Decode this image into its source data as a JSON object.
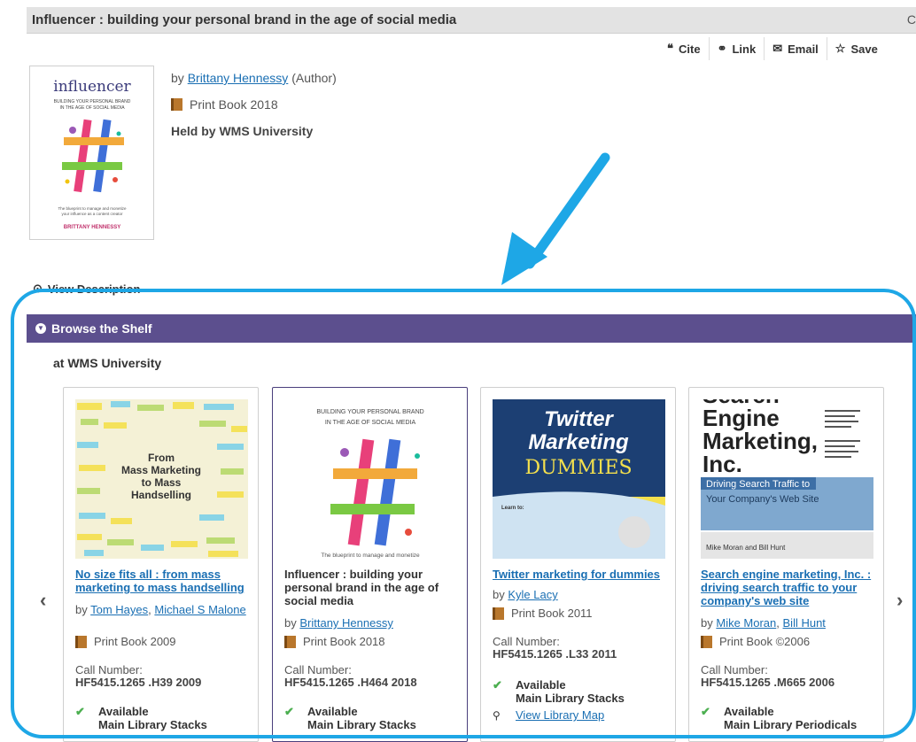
{
  "record": {
    "title": "Influencer : building your personal brand in the age of social media",
    "edge_glyph": "C",
    "by_prefix": "by",
    "author": "Brittany Hennessy",
    "author_role": "(Author)",
    "format": "Print Book 2018",
    "held_by": "Held by WMS University"
  },
  "actions": [
    {
      "label": "Cite",
      "icon": "quote-icon",
      "glyph": "❝"
    },
    {
      "label": "Link",
      "icon": "link-icon",
      "glyph": "⚭"
    },
    {
      "label": "Email",
      "icon": "envelope-icon",
      "glyph": "✉"
    },
    {
      "label": "Save",
      "icon": "star-icon",
      "glyph": "☆"
    }
  ],
  "cover": {
    "title": "influencer",
    "subtitle_1": "BUILDING YOUR PERSONAL BRAND",
    "subtitle_2": "IN THE AGE OF SOCIAL MEDIA",
    "blurb_1": "The blueprint to manage and monetize",
    "blurb_2": "your influence as a content creator",
    "author": "BRITTANY HENNESSY"
  },
  "view_description": "View Description",
  "shelf": {
    "header": "Browse the Shelf",
    "location": "at WMS University",
    "prev_glyph": "‹",
    "next_glyph": "›",
    "books": [
      {
        "title": "No size fits all : from mass marketing to mass handselling",
        "by_prefix": "by",
        "authors": [
          "Tom Hayes",
          "Michael S Malone"
        ],
        "format": "Print Book 2009",
        "call_label": "Call Number:",
        "call_number": "HF5415.1265 .H39 2009",
        "availability": "Available",
        "location": "Main Library Stacks",
        "cover_text": [
          "From",
          "Mass Marketing",
          "to Mass",
          "Handselling"
        ]
      },
      {
        "title": "Influencer : building your personal brand in the age of social media",
        "by_prefix": "by",
        "authors": [
          "Brittany Hennessy"
        ],
        "format": "Print Book 2018",
        "call_label": "Call Number:",
        "call_number": "HF5415.1265 .H464 2018",
        "availability": "Available",
        "location": "Main Library Stacks",
        "cover_text": [
          "BUILDING YOUR PERSONAL BRAND",
          "IN THE AGE OF SOCIAL MEDIA",
          "The blueprint to manage and monetize"
        ]
      },
      {
        "title": "Twitter marketing for dummies",
        "by_prefix": "by",
        "authors": [
          "Kyle Lacy"
        ],
        "format": "Print Book 2011",
        "call_label": "Call Number:",
        "call_number": "HF5415.1265 .L33 2011",
        "availability": "Available",
        "location": "Main Library Stacks",
        "map_link": "View Library Map",
        "cover_text": [
          "Twitter",
          "Marketing",
          "DUMMIES",
          "Learn to:"
        ]
      },
      {
        "title": "Search engine marketing, Inc. : driving search traffic to your company's web site",
        "by_prefix": "by",
        "authors": [
          "Mike Moran",
          "Bill Hunt"
        ],
        "format": "Print Book ©2006",
        "call_label": "Call Number:",
        "call_number": "HF5415.1265 .M665 2006",
        "availability": "Available",
        "location": "Main Library Periodicals",
        "cover_text": [
          "Search",
          "Engine",
          "Marketing,",
          "Inc.",
          "Driving Search Traffic to",
          "Your Company's Web Site",
          "Mike Moran and Bill Hunt"
        ]
      }
    ]
  },
  "colors": {
    "shelf_header": "#5c4f8e",
    "link": "#1a6fb3",
    "annotation": "#1ea7e6",
    "available": "#4caf50"
  }
}
